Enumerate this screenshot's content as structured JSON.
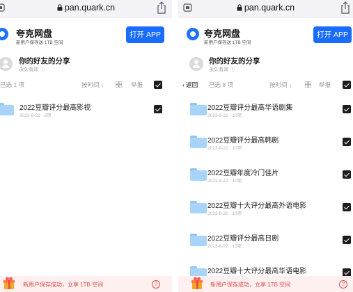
{
  "left": {
    "url": "pan.quark.cn",
    "app": {
      "name": "夸克网盘",
      "slogan": "新用户保存送 1TB 空间",
      "open_label": "打开 APP"
    },
    "sharer": {
      "title": "你的好友的分享",
      "validity": "永久有效"
    },
    "toolbar": {
      "selected": "已选 1 项",
      "sort": "按时间",
      "report": "举报"
    },
    "items": [
      {
        "name": "2022豆瓣评分最高影视",
        "meta": "2023-8-22 · 8项",
        "checked": true
      }
    ],
    "banner": {
      "text": "新用户保存成功，立享 1TB 空间"
    }
  },
  "right": {
    "url": "pan.quark.cn",
    "app": {
      "name": "夸克网盘",
      "slogan": "新用户保存送 1TB 空间",
      "open_label": "打开 APP"
    },
    "sharer": {
      "title": "你的好友的分享",
      "validity": "永久有效"
    },
    "toolbar": {
      "back": "返回",
      "selected": "已选 8 项",
      "sort": "按时间",
      "report": "举报"
    },
    "items": [
      {
        "name": "2022豆瓣评分最高华语剧集",
        "meta": "2023-8-22 · 10项",
        "checked": true
      },
      {
        "name": "2022豆瓣评分最高韩剧",
        "meta": "2023-8-22 · 10项",
        "checked": true
      },
      {
        "name": "2022豆瓣年度冷门佳片",
        "meta": "2023-8-22 · 10项",
        "checked": true
      },
      {
        "name": "2022豆瓣十大评分最高外语电影",
        "meta": "2023-8-22 · 10项",
        "checked": true
      },
      {
        "name": "2022豆瓣评分最高日剧",
        "meta": "2023-8-22 · 10项",
        "checked": true
      },
      {
        "name": "2022豆瓣十大评分最高华语电影",
        "meta": "2023-8-22 · 10项",
        "checked": true
      }
    ],
    "banner": {
      "text": "新用户保存成功，立享 1TB 空间"
    }
  },
  "colors": {
    "brand_blue": "#1a6cff",
    "folder_blue": "#a9d4fa",
    "banner_red": "#e34848",
    "banner_bg": "#fff0f0"
  }
}
